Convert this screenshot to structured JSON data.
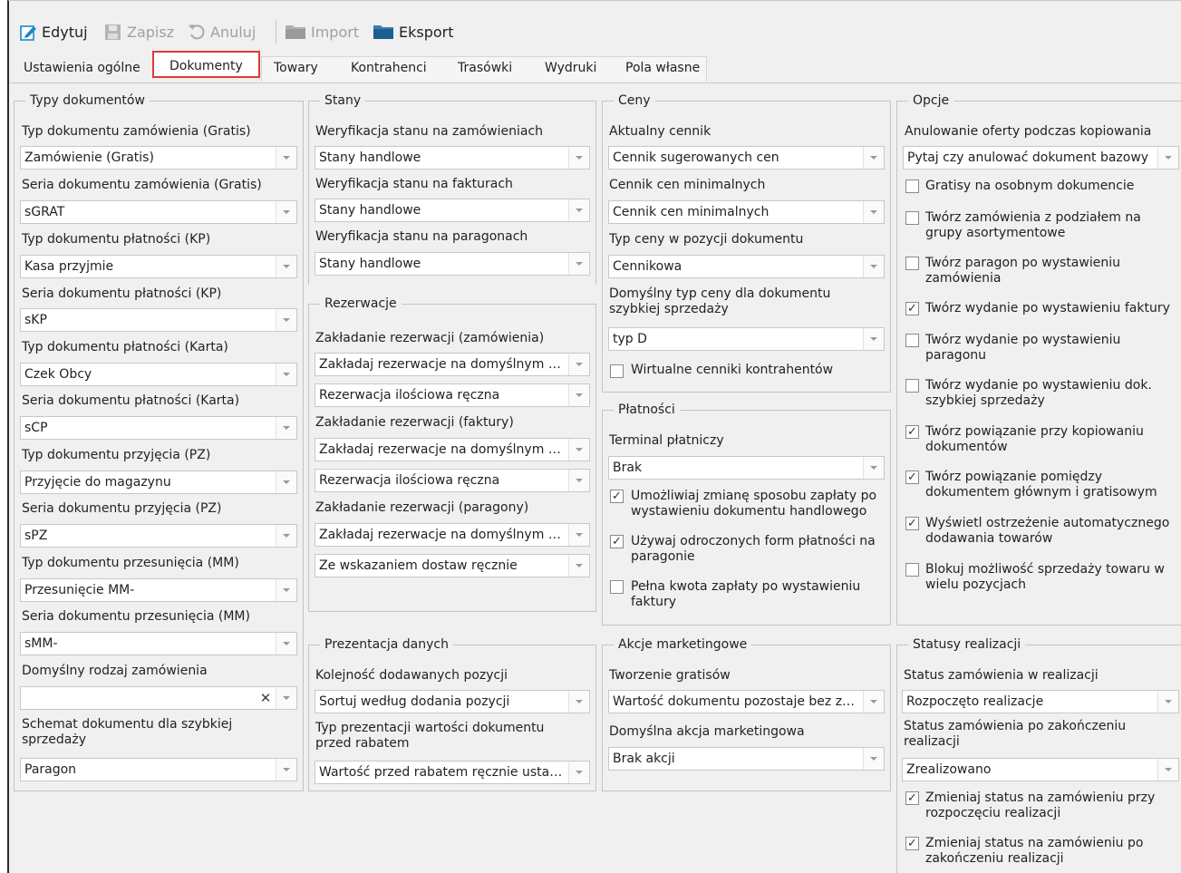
{
  "toolbar": {
    "edit": "Edytuj",
    "save": "Zapisz",
    "cancel": "Anuluj",
    "import": "Import",
    "export": "Eksport"
  },
  "tabs": [
    "Ustawienia ogólne",
    "Dokumenty",
    "Towary",
    "Kontrahenci",
    "Trasówki",
    "Wydruki",
    "Pola własne"
  ],
  "active_tab": "Dokumenty",
  "typy": {
    "title": "Typy dokumentów",
    "fields": [
      {
        "label": "Typ dokumentu zamówienia (Gratis)",
        "value": "Zamówienie (Gratis)"
      },
      {
        "label": "Seria dokumentu zamówienia (Gratis)",
        "value": "sGRAT"
      },
      {
        "label": "Typ dokumentu płatności (KP)",
        "value": "Kasa przyjmie"
      },
      {
        "label": "Seria dokumentu płatności (KP)",
        "value": "sKP"
      },
      {
        "label": "Typ dokumentu płatności (Karta)",
        "value": "Czek Obcy"
      },
      {
        "label": "Seria dokumentu płatności (Karta)",
        "value": "sCP"
      },
      {
        "label": "Typ dokumentu przyjęcia (PZ)",
        "value": "Przyjęcie do magazynu"
      },
      {
        "label": "Seria dokumentu przyjęcia (PZ)",
        "value": "sPZ"
      },
      {
        "label": "Typ dokumentu przesunięcia (MM)",
        "value": "Przesunięcie MM-"
      },
      {
        "label": "Seria dokumentu przesunięcia (MM)",
        "value": "sMM-"
      },
      {
        "label": "Domyślny rodzaj zamówienia",
        "value": ""
      },
      {
        "label": "Schemat dokumentu dla szybkiej sprzedaży",
        "value": "Paragon"
      }
    ]
  },
  "stany": {
    "title": "Stany",
    "fields": [
      {
        "label": "Weryfikacja stanu na zamówieniach",
        "value": "Stany handlowe"
      },
      {
        "label": "Weryfikacja stanu na fakturach",
        "value": "Stany handlowe"
      },
      {
        "label": "Weryfikacja stanu na paragonach",
        "value": "Stany handlowe"
      }
    ]
  },
  "rezerwacje": {
    "title": "Rezerwacje",
    "label1": "Zakładanie rezerwacji (zamówienia)",
    "v1a": "Zakładaj rezerwacje na domyślnym magazynie",
    "v1b": "Rezerwacja ilościowa ręczna",
    "label2": "Zakładanie rezerwacji (faktury)",
    "v2a": "Zakładaj rezerwacje na domyślnym magazynie",
    "v2b": "Rezerwacja ilościowa ręczna",
    "label3": "Zakładanie rezerwacji (paragony)",
    "v3a": "Zakładaj rezerwacje na domyślnym magazynie",
    "v3b": "Ze wskazaniem dostaw ręcznie"
  },
  "prezentacja": {
    "title": "Prezentacja danych",
    "label1": "Kolejność dodawanych pozycji",
    "v1": "Sortuj według dodania pozycji",
    "label2": "Typ prezentacji wartości dokumentu przed rabatem",
    "v2": "Wartość przed rabatem ręcznie ustalana"
  },
  "ceny": {
    "title": "Ceny",
    "label1": "Aktualny cennik",
    "v1": "Cennik sugerowanych cen",
    "label2": "Cennik cen minimalnych",
    "v2": "Cennik cen minimalnych",
    "label3": "Typ ceny w pozycji dokumentu",
    "v3": "Cennikowa",
    "label4": "Domyślny typ ceny dla dokumentu szybkiej sprzedaży",
    "v4": "typ D",
    "chk1": "Wirtualne cenniki kontrahentów"
  },
  "platnosci": {
    "title": "Płatności",
    "label1": "Terminal płatniczy",
    "v1": "Brak",
    "checks": [
      {
        "label": "Umożliwiaj zmianę sposobu zapłaty po wystawieniu dokumentu handlowego",
        "checked": true
      },
      {
        "label": "Używaj odroczonych form płatności na paragonie",
        "checked": true
      },
      {
        "label": "Pełna kwota zapłaty po wystawieniu faktury",
        "checked": false
      }
    ]
  },
  "akcje": {
    "title": "Akcje marketingowe",
    "label1": "Tworzenie gratisów",
    "v1": "Wartość dokumentu pozostaje bez zmian",
    "label2": "Domyślna akcja marketingowa",
    "v2": "Brak akcji"
  },
  "opcje": {
    "title": "Opcje",
    "label1": "Anulowanie oferty podczas kopiowania",
    "v1": "Pytaj czy anulować dokument bazowy",
    "checks": [
      {
        "label": "Gratisy na osobnym dokumencie",
        "checked": false
      },
      {
        "label": "Twórz zamówienia z podziałem na grupy asortymentowe",
        "checked": false
      },
      {
        "label": "Twórz paragon po wystawieniu zamówienia",
        "checked": false
      },
      {
        "label": "Twórz wydanie po wystawieniu faktury",
        "checked": true
      },
      {
        "label": "Twórz wydanie po wystawieniu paragonu",
        "checked": false
      },
      {
        "label": "Twórz wydanie po wystawieniu dok. szybkiej sprzedaży",
        "checked": false
      },
      {
        "label": "Twórz powiązanie przy kopiowaniu dokumentów",
        "checked": true
      },
      {
        "label": "Twórz powiązanie pomiędzy dokumentem głównym i gratisowym",
        "checked": true
      },
      {
        "label": "Wyświetl ostrzeżenie automatycznego dodawania towarów",
        "checked": true
      },
      {
        "label": "Blokuj możliwość sprzedaży towaru w wielu pozycjach",
        "checked": false
      }
    ]
  },
  "statusy": {
    "title": "Statusy realizacji",
    "label1": "Status zamówienia w realizacji",
    "v1": "Rozpoczęto realizacje",
    "label2": "Status zamówienia po zakończeniu realizacji",
    "v2": "Zrealizowano",
    "checks": [
      {
        "label": "Zmieniaj status na zamówieniu przy rozpoczęciu realizacji",
        "checked": true
      },
      {
        "label": "Zmieniaj status na zamówieniu po zakończeniu realizacji",
        "checked": true
      }
    ]
  },
  "colors": {
    "active_tab_border": "#e13838",
    "panel_bg": "#f0f0f0",
    "accent_icon": "#1e88c8"
  },
  "icons": [
    "edit-icon",
    "save-icon",
    "undo-icon",
    "folder-icon",
    "folder-icon",
    "check-icon",
    "chevron-down-icon",
    "clear-icon"
  ]
}
